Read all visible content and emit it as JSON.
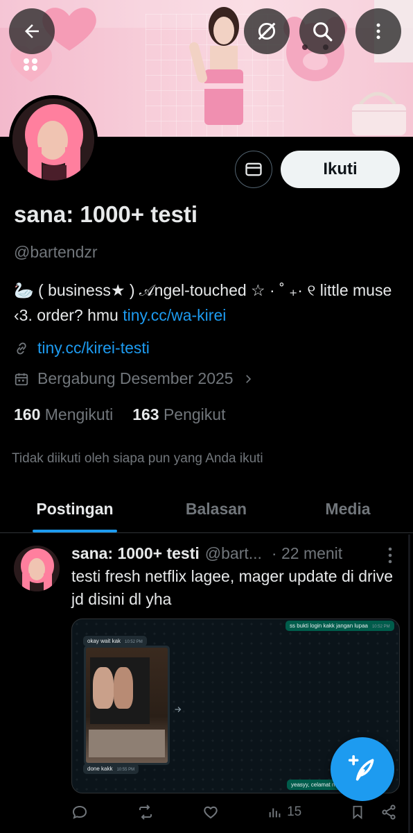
{
  "profile": {
    "display_name": "sana: 1000+ testi",
    "handle": "@bartendzr",
    "bio_text": "🦢 ( business★ ) 𝒜ngel-touched ☆ · ˚ ₊· ୧ little muse ‹3. order? hmu ",
    "bio_link": "tiny.cc/wa-kirei",
    "website": "tiny.cc/kirei-testi",
    "joined": "Bergabung Desember 2025",
    "following_count": "160",
    "following_label": "Mengikuti",
    "followers_count": "163",
    "followers_label": "Pengikut",
    "followed_by_note": "Tidak diikuti oleh siapa pun yang Anda ikuti"
  },
  "actions": {
    "follow_label": "Ikuti"
  },
  "tabs": [
    {
      "label": "Postingan",
      "active": true
    },
    {
      "label": "Balasan",
      "active": false
    },
    {
      "label": "Media",
      "active": false
    }
  ],
  "post": {
    "author_name": "sana: 1000+ testi",
    "author_handle": "@bart...",
    "time": "· 22 menit",
    "text": "testi fresh netflix lagee, mager update di drive jd disini dl yha",
    "views": "15",
    "chat": {
      "msg_out_1": "ss bukti login kakk jangan lupaa",
      "msg_out_1_time": "10:52 PM",
      "msg_in_1": "okay wait kak",
      "msg_in_1_time": "10:52 PM",
      "msg_in_2": "done kakk",
      "msg_in_2_time": "10:55 PM",
      "msg_out_2": "yeasyy, celamat me"
    }
  },
  "icons": {
    "back": "arrow-left-icon",
    "hide": "eye-slash-icon",
    "search": "search-icon",
    "more": "more-vertical-icon",
    "message": "envelope-icon",
    "link": "link-icon",
    "calendar": "calendar-icon",
    "compose": "feather-plus-icon"
  },
  "colors": {
    "accent": "#1d9bf0",
    "background": "#000000",
    "muted": "#71767b",
    "text": "#e7e9ea"
  }
}
